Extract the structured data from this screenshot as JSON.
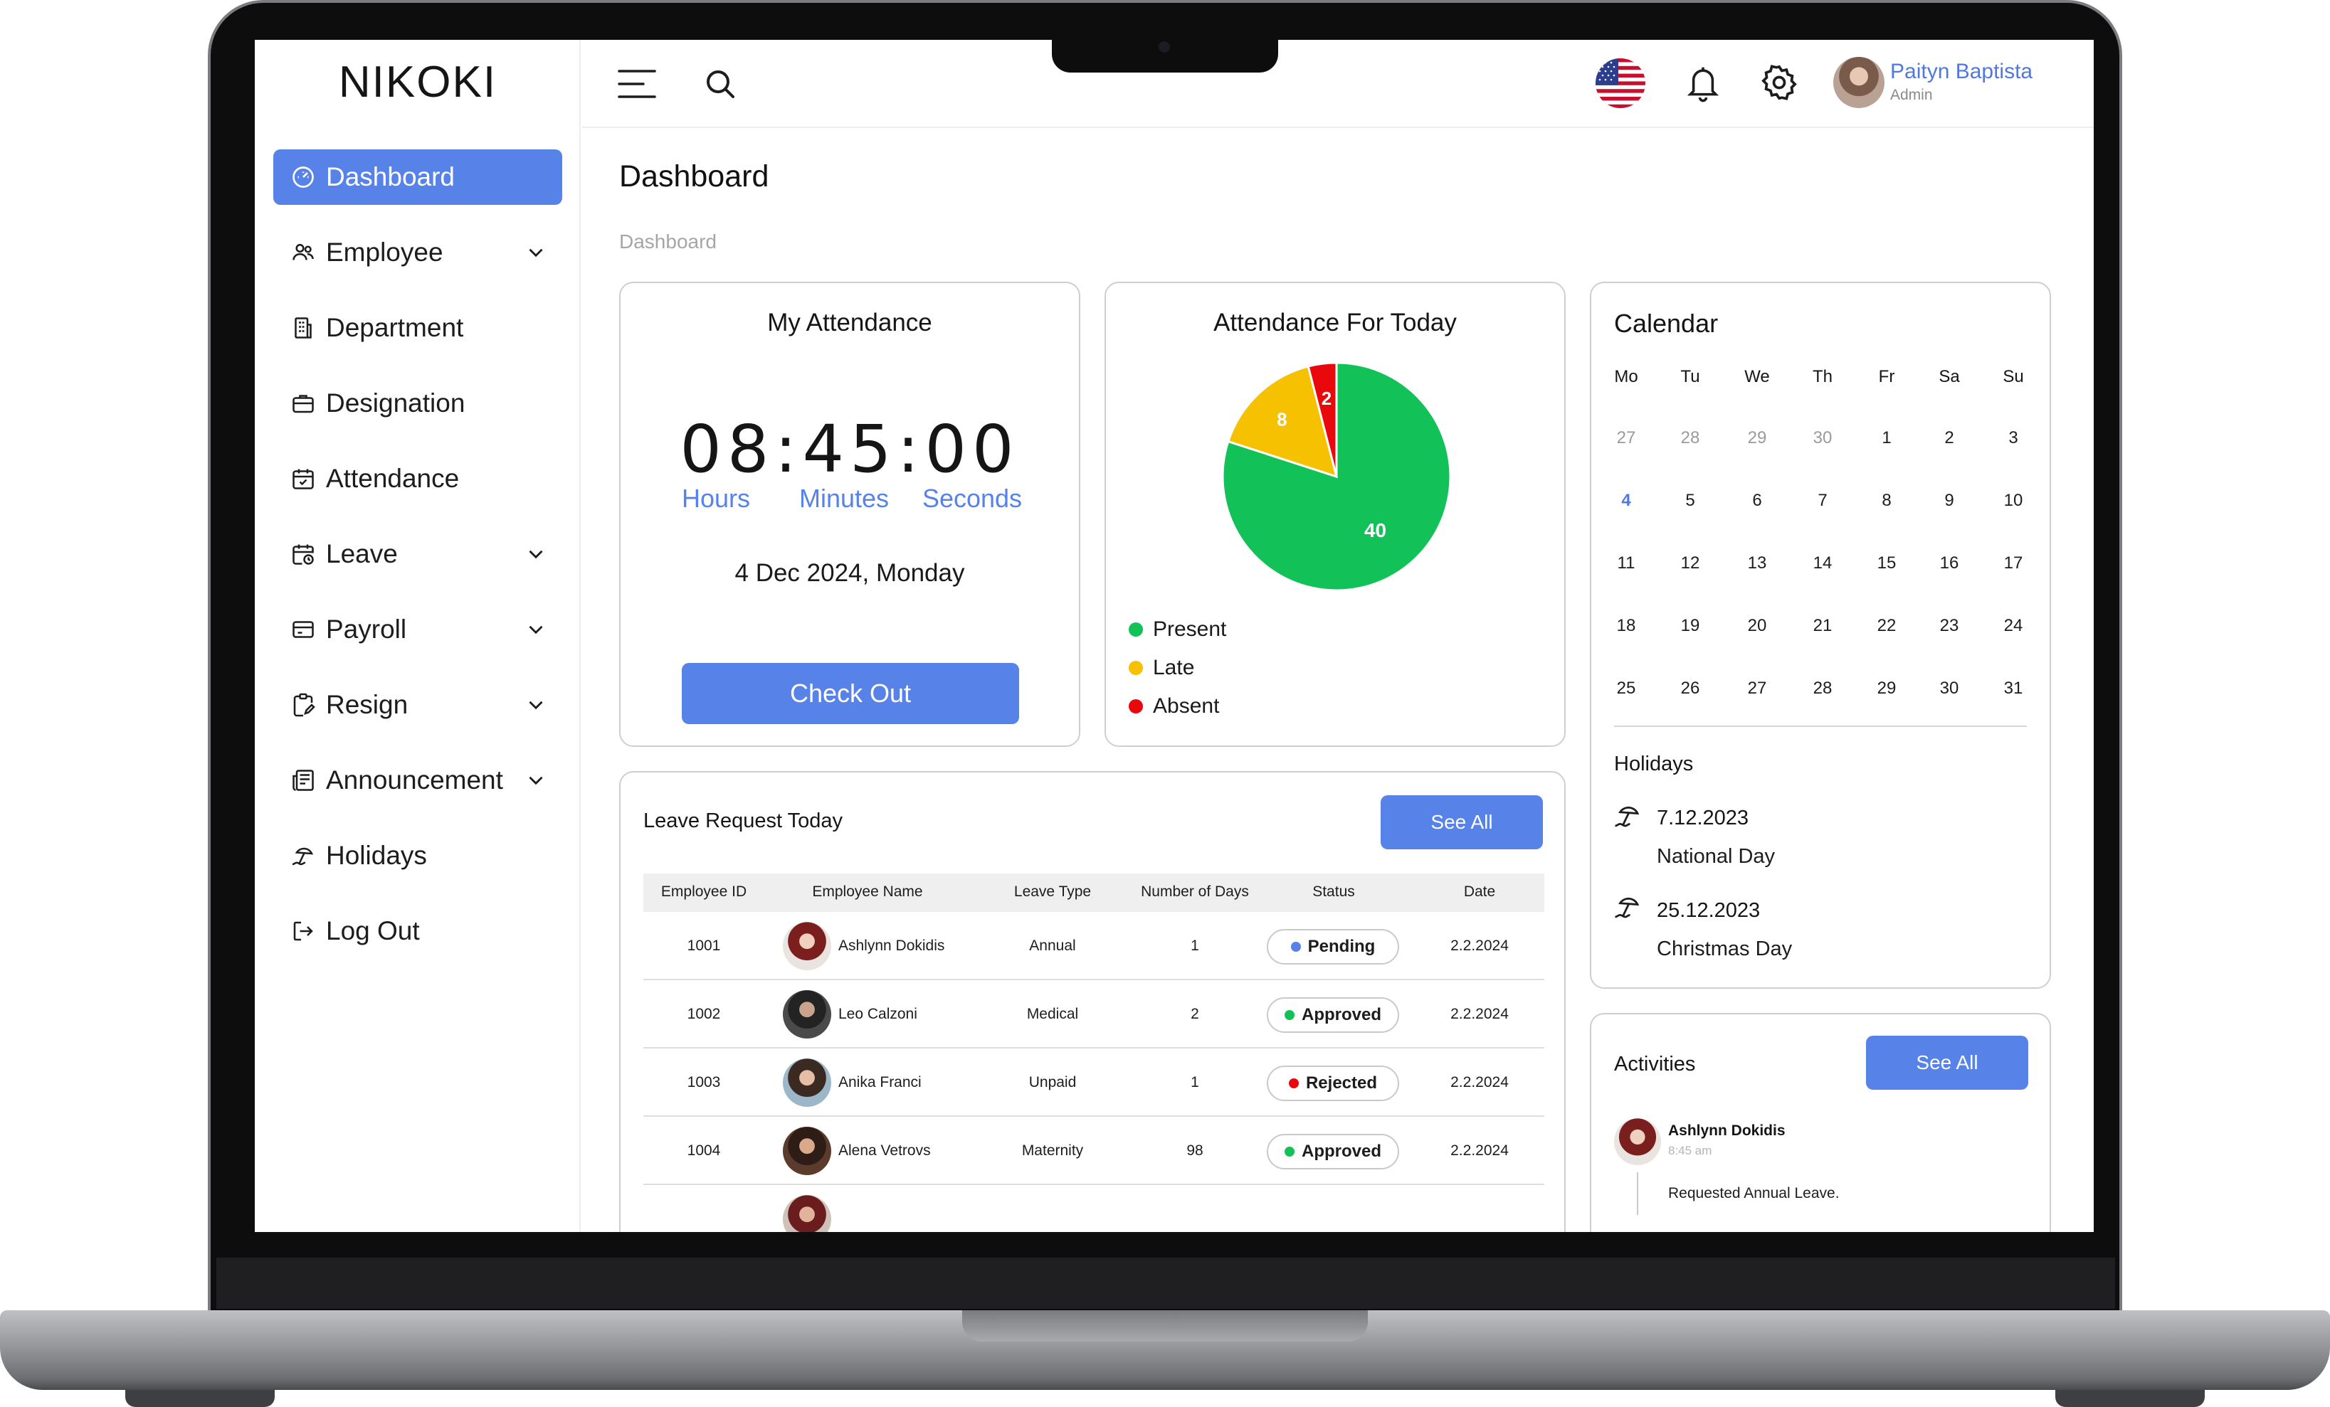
{
  "app": {
    "logo": "NIKOKI"
  },
  "sidebar": {
    "items": [
      {
        "label": "Dashboard"
      },
      {
        "label": "Employee"
      },
      {
        "label": "Department"
      },
      {
        "label": "Designation"
      },
      {
        "label": "Attendance"
      },
      {
        "label": "Leave"
      },
      {
        "label": "Payroll"
      },
      {
        "label": "Resign"
      },
      {
        "label": "Announcement"
      },
      {
        "label": "Holidays"
      },
      {
        "label": "Log Out"
      }
    ]
  },
  "header": {
    "user_name": "Paityn Baptista",
    "user_role": "Admin"
  },
  "page": {
    "title": "Dashboard",
    "breadcrumb": "Dashboard"
  },
  "attendance": {
    "title": "My Attendance",
    "clock": "08:45:00",
    "hours_label": "Hours",
    "minutes_label": "Minutes",
    "seconds_label": "Seconds",
    "date": "4 Dec 2024, Monday",
    "checkout_label": "Check Out"
  },
  "today": {
    "title": "Attendance For Today",
    "legend": [
      {
        "label": "Present",
        "color": "#12c157"
      },
      {
        "label": "Late",
        "color": "#f6c100"
      },
      {
        "label": "Absent",
        "color": "#e9090c"
      }
    ]
  },
  "chart_data": {
    "type": "pie",
    "title": "Attendance For Today",
    "slices": [
      {
        "label": "Present",
        "value": 40,
        "color": "#12c157"
      },
      {
        "label": "Late",
        "value": 8,
        "color": "#f6c100"
      },
      {
        "label": "Absent",
        "value": 2,
        "color": "#e9090c"
      }
    ],
    "legend_position": "bottom-left"
  },
  "calendar": {
    "title": "Calendar",
    "weekdays": [
      "Mo",
      "Tu",
      "We",
      "Th",
      "Fr",
      "Sa",
      "Su"
    ],
    "weeks": [
      [
        "27",
        "28",
        "29",
        "30",
        "1",
        "2",
        "3"
      ],
      [
        "4",
        "5",
        "6",
        "7",
        "8",
        "9",
        "10"
      ],
      [
        "11",
        "12",
        "13",
        "14",
        "15",
        "16",
        "17"
      ],
      [
        "18",
        "19",
        "20",
        "21",
        "22",
        "23",
        "24"
      ],
      [
        "25",
        "26",
        "27",
        "28",
        "29",
        "30",
        "31"
      ]
    ],
    "today": "4",
    "holidays_title": "Holidays",
    "holidays": [
      {
        "date": "7.12.2023",
        "name": "National Day"
      },
      {
        "date": "25.12.2023",
        "name": "Christmas Day"
      }
    ]
  },
  "leave": {
    "title": "Leave Request Today",
    "see_all": "See All",
    "columns": [
      "Employee ID",
      "Employee Name",
      "Leave Type",
      "Number of Days",
      "Status",
      "Date"
    ],
    "rows": [
      {
        "id": "1001",
        "name": "Ashlynn Dokidis",
        "type": "Annual",
        "days": "1",
        "status": "Pending",
        "status_color": "#5782e8",
        "date": "2.2.2024"
      },
      {
        "id": "1002",
        "name": "Leo Calzoni",
        "type": "Medical",
        "days": "2",
        "status": "Approved",
        "status_color": "#12c157",
        "date": "2.2.2024"
      },
      {
        "id": "1003",
        "name": "Anika Franci",
        "type": "Unpaid",
        "days": "1",
        "status": "Rejected",
        "status_color": "#e9090c",
        "date": "2.2.2024"
      },
      {
        "id": "1004",
        "name": "Alena Vetrovs",
        "type": "Maternity",
        "days": "98",
        "status": "Approved",
        "status_color": "#12c157",
        "date": "2.2.2024"
      }
    ]
  },
  "activities": {
    "title": "Activities",
    "see_all": "See All",
    "items": [
      {
        "name": "Ashlynn Dokidis",
        "time": "8:45 am",
        "text": "Requested Annual Leave."
      }
    ]
  }
}
